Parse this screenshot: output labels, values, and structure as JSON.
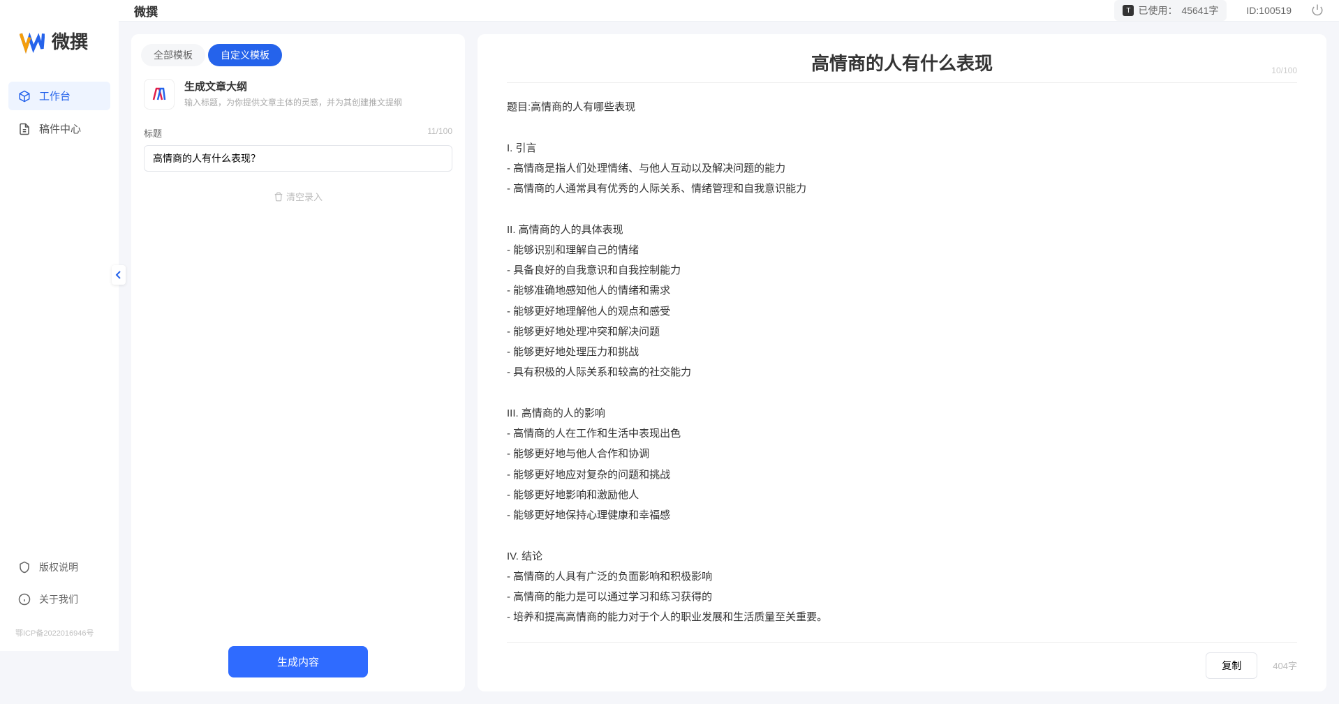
{
  "app": {
    "name": "微撰",
    "topbar_title": "微撰"
  },
  "sidebar": {
    "nav": [
      {
        "label": "工作台",
        "icon": "cube",
        "active": true
      },
      {
        "label": "稿件中心",
        "icon": "doc",
        "active": false
      }
    ],
    "footer": [
      {
        "label": "版权说明",
        "icon": "shield"
      },
      {
        "label": "关于我们",
        "icon": "info"
      }
    ],
    "icp": "鄂ICP备2022016946号"
  },
  "topbar": {
    "usage_prefix": "已使用：",
    "usage_value": "45641字",
    "id_label": "ID:",
    "id_value": "100519"
  },
  "left": {
    "tabs": [
      {
        "label": "全部模板",
        "active": false
      },
      {
        "label": "自定义模板",
        "active": true
      }
    ],
    "template": {
      "title": "生成文章大纲",
      "desc": "输入标题，为你提供文章主体的灵感，并为其创建推文提纲"
    },
    "field_label": "标题",
    "field_count": "11/100",
    "title_value": "高情商的人有什么表现？",
    "clear_label": "清空录入",
    "generate_label": "生成内容"
  },
  "right": {
    "title": "高情商的人有什么表现",
    "title_count": "10/100",
    "body": "题目:高情商的人有哪些表现\n\nI. 引言\n- 高情商是指人们处理情绪、与他人互动以及解决问题的能力\n- 高情商的人通常具有优秀的人际关系、情绪管理和自我意识能力\n\nII. 高情商的人的具体表现\n- 能够识别和理解自己的情绪\n- 具备良好的自我意识和自我控制能力\n- 能够准确地感知他人的情绪和需求\n- 能够更好地理解他人的观点和感受\n- 能够更好地处理冲突和解决问题\n- 能够更好地处理压力和挑战\n- 具有积极的人际关系和较高的社交能力\n\nIII. 高情商的人的影响\n- 高情商的人在工作和生活中表现出色\n- 能够更好地与他人合作和协调\n- 能够更好地应对复杂的问题和挑战\n- 能够更好地影响和激励他人\n- 能够更好地保持心理健康和幸福感\n\nIV. 结论\n- 高情商的人具有广泛的负面影响和积极影响\n- 高情商的能力是可以通过学习和练习获得的\n- 培养和提高高情商的能力对于个人的职业发展和生活质量至关重要。",
    "copy_label": "复制",
    "word_count": "404字"
  }
}
